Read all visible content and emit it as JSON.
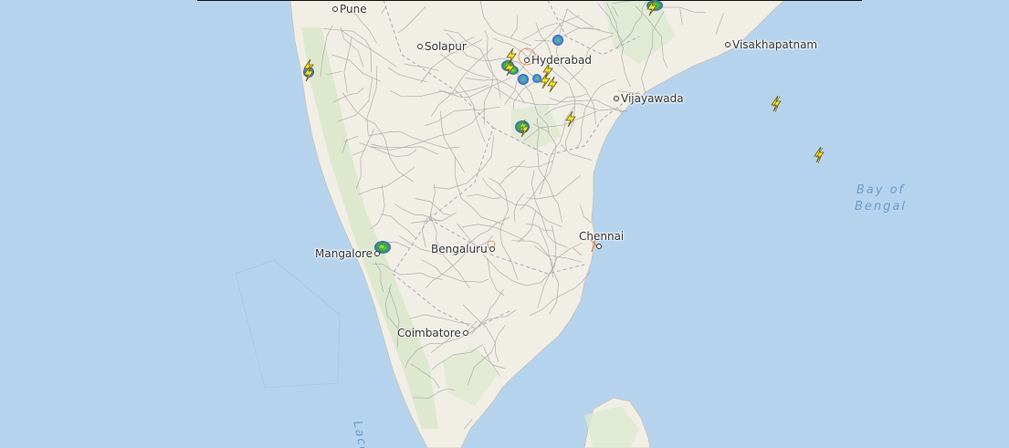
{
  "map": {
    "colors": {
      "sea": "#b6d3ee",
      "land": "#f1eee6",
      "forest": "#d6e3c6",
      "road": "#9a9a9a",
      "lightning": "#f2e52a",
      "storm_green": "#5cc74a",
      "storm_blue": "#4a7fd6"
    },
    "cities": [
      {
        "name": "Pune",
        "id": "pune"
      },
      {
        "name": "Solapur",
        "id": "solapur"
      },
      {
        "name": "Hyderabad",
        "id": "hyderabad"
      },
      {
        "name": "Visakhapatnam",
        "id": "visakhapatnam"
      },
      {
        "name": "Vijayawada",
        "id": "vijayawada"
      },
      {
        "name": "Bengaluru",
        "id": "bengaluru"
      },
      {
        "name": "Chennai",
        "id": "chennai"
      },
      {
        "name": "Mangalore",
        "id": "mangalore"
      },
      {
        "name": "Coimbatore",
        "id": "coimbatore"
      }
    ],
    "water_labels": {
      "bay_line1": "Bay of",
      "bay_line2": "Bengal",
      "laccadive": "Lacc"
    },
    "markers": {
      "lightning_count": 14,
      "storm_cell_count": 10,
      "icon": "lightning-bolt-icon"
    }
  }
}
